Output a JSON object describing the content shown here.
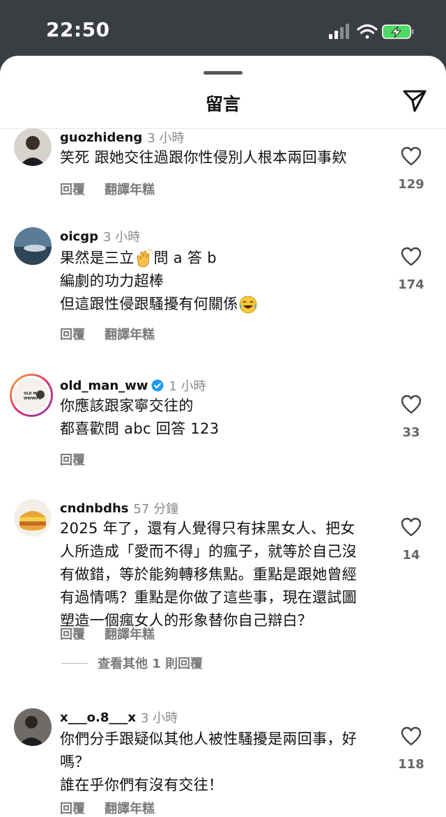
{
  "status_bar": {
    "time": "22:50"
  },
  "header": {
    "title": "留言"
  },
  "comments": [
    {
      "username": "guozhideng",
      "time": "3 小時",
      "lines": [
        "笑死 跟她交往過跟你性侵別人根本兩回事欸"
      ],
      "reply": "回覆",
      "translate": "翻譯年糕",
      "likes": "129"
    },
    {
      "username": "oicgp",
      "time": "3 小時",
      "lines": [
        "果然是三立",
        "問 a 答 b",
        "編劇的功力超棒",
        "但這跟性侵跟騷擾有何關係"
      ],
      "reply": "回覆",
      "translate": "翻譯年糕",
      "likes": "174"
    },
    {
      "username": "old_man_ww",
      "verified": true,
      "time": "1 小時",
      "avatar_text": "OLD MAN WWWIFE",
      "lines": [
        "你應該跟家寧交往的",
        "都喜歡問 abc 回答 123"
      ],
      "reply": "回覆",
      "likes": "33"
    },
    {
      "username": "cndnbdhs",
      "time": "57 分鐘",
      "lines": [
        "2025 年了，還有人覺得只有抹黑女人、把女",
        "人所造成「愛而不得」的瘋子，就等於自己沒",
        "有做錯，等於能夠轉移焦點。重點是跟她曾經",
        "有過情嗎？重點是你做了這些事，現在還試圖",
        "塑造一個瘋女人的形象替你自己辯白？"
      ],
      "reply": "回覆",
      "translate": "翻譯年糕",
      "likes": "14"
    },
    {
      "username": "x___o.8___x",
      "time": "3 小時",
      "lines": [
        "你們分手跟疑似其他人被性騷擾是兩回事，好",
        "嗎？",
        "誰在乎你們有沒有交往！"
      ],
      "reply": "回覆",
      "translate": "翻譯年糕",
      "likes": "118"
    }
  ],
  "view_more_replies": "查看其他 1 則回覆",
  "icons": {
    "share": "paper-plane-icon",
    "like": "heart-icon",
    "verified": "verified-badge-icon",
    "signal": "signal-icon",
    "wifi": "wifi-icon",
    "battery": "battery-charging-icon",
    "emoji_clap": "clapping-hands-emoji",
    "emoji_laugh": "tears-of-joy-emoji"
  },
  "colors": {
    "verified_blue": "#1d9bf0",
    "battery_green": "#4cd964",
    "status_bg": "#3a3d42"
  }
}
